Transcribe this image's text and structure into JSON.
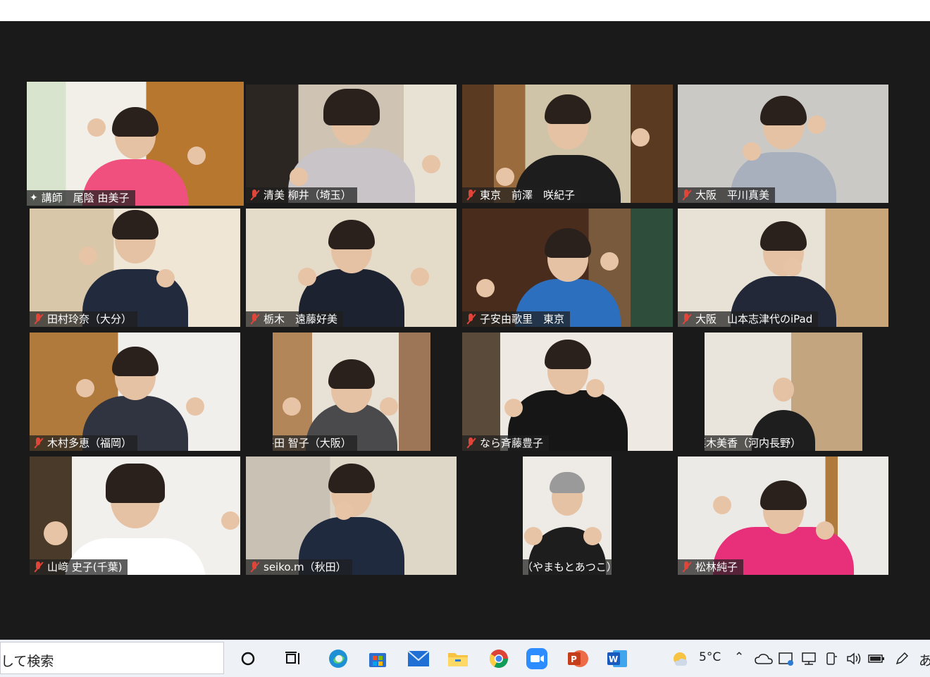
{
  "participants": [
    {
      "name": "講師　尾陰 由美子",
      "host": true,
      "active_speaker": true
    },
    {
      "name": "清美 柳井（埼玉）"
    },
    {
      "name": "東京　前澤　咲紀子"
    },
    {
      "name": "大阪　平川真美"
    },
    {
      "name": "田村玲奈（大分）"
    },
    {
      "name": "栃木　遠藤好美"
    },
    {
      "name": "子安由歌里　東京"
    },
    {
      "name": "大阪　山本志津代のiPad"
    },
    {
      "name": "木村多恵（福岡）"
    },
    {
      "name": "平田 智子（大阪）"
    },
    {
      "name": "なら斉藤豊子"
    },
    {
      "name": "栗木美香（河内長野）"
    },
    {
      "name": "山﨑 史子(千葉)"
    },
    {
      "name": "seiko.m（秋田）"
    },
    {
      "name": "山本淳子（やまもとあつこ）群馬"
    },
    {
      "name": "松林純子"
    }
  ],
  "taskbar": {
    "search_text": "して検索",
    "weather": "5°C",
    "ime": "あ",
    "apps": [
      "cortana-icon",
      "task-view-icon",
      "edge-icon",
      "store-icon",
      "mail-icon",
      "file-explorer-icon",
      "chrome-icon",
      "zoom-icon",
      "powerpoint-icon",
      "word-icon"
    ]
  },
  "colors": {
    "meeting_bg": "#1a1a1a",
    "active_border": "#e4ee7a",
    "muted_mic": "#e0453a"
  }
}
